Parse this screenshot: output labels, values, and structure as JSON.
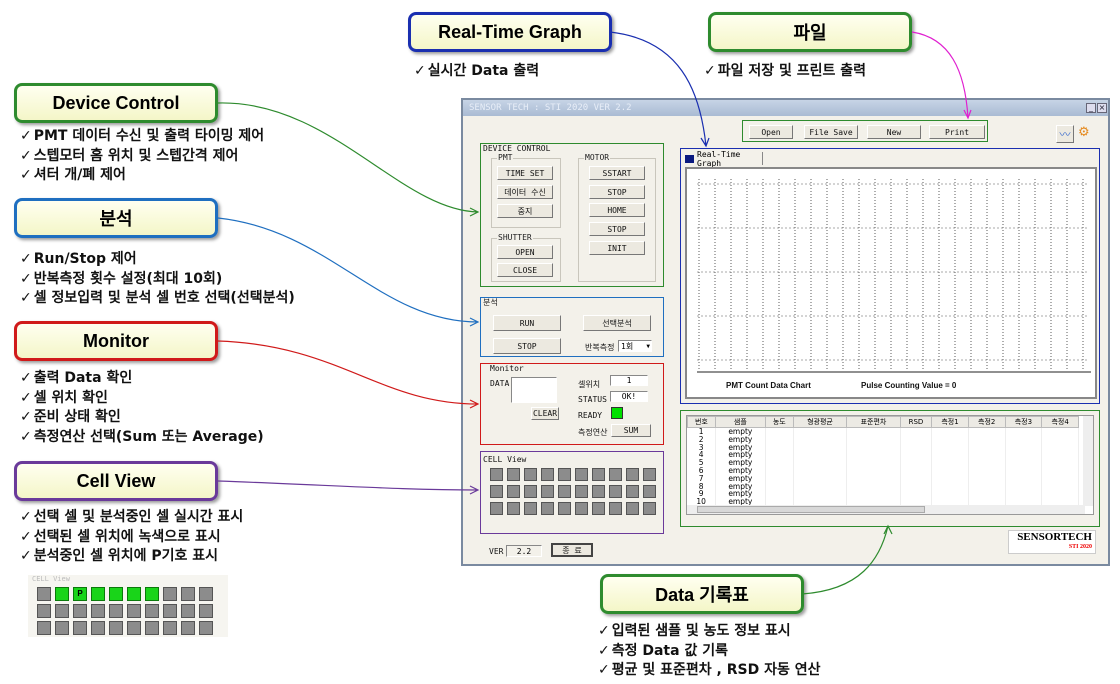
{
  "callouts": {
    "device_control": {
      "title": "Device Control",
      "color": "#2e8b2e",
      "notes": [
        "PMT 데이터 수신 및 출력 타이밍 제어",
        "스텝모터 홈 위치 및 스텝간격 제어",
        "셔터 개/폐 제어"
      ]
    },
    "analysis": {
      "title": "분석",
      "color": "#1f6fc0",
      "notes": [
        "Run/Stop 제어",
        "반복측정 횟수 설정(최대 10회)",
        "셀 정보입력 및 분석 셀 번호 선택(선택분석)"
      ]
    },
    "monitor": {
      "title": "Monitor",
      "color": "#d01a1a",
      "notes": [
        "출력 Data 확인",
        "셀 위치 확인",
        "준비 상태 확인",
        "측정연산 선택(Sum 또는 Average)"
      ]
    },
    "cell_view": {
      "title": "Cell View",
      "color": "#6a3a9a",
      "notes": [
        "선택 셀 및 분석중인 셀 실시간 표시",
        "선택된 셀 위치에 녹색으로 표시",
        "분석중인 셀 위치에 P기호 표시"
      ]
    },
    "realtime": {
      "title": "Real-Time Graph",
      "color": "#1a2fb0",
      "notes": [
        "실시간 Data 출력"
      ]
    },
    "file": {
      "title": "파일",
      "color": "#2e8b2e",
      "notes": [
        "파일 저장 및 프린트 출력"
      ]
    },
    "data_table": {
      "title": "Data 기록표",
      "color": "#2e8b2e",
      "notes": [
        "입력된 샘플 및 농도 정보 표시",
        "측정 Data 값 기록",
        "평균 및 표준편차 , RSD 자동 연산"
      ]
    }
  },
  "example_cell_view": {
    "label": "CELL View",
    "green_cells": [
      2,
      3,
      4,
      5,
      6,
      7
    ],
    "p_cell": 3,
    "p_label": "P"
  },
  "app": {
    "title": "SENSOR TECH : STI 2020  VER 2.2",
    "device_control": {
      "label": "DEVICE CONTROL",
      "pmt": {
        "label": "PMT",
        "buttons": [
          "TIME SET",
          "데이터 수신",
          "중지"
        ]
      },
      "motor": {
        "label": "MOTOR",
        "buttons": [
          "SSTART",
          "STOP",
          "HOME",
          "STOP",
          "INIT"
        ]
      },
      "shutter": {
        "label": "SHUTTER",
        "buttons": [
          "OPEN",
          "CLOSE"
        ]
      }
    },
    "analysis": {
      "label": "분석",
      "run": "RUN",
      "stop": "STOP",
      "select": "선택분석",
      "repeat_label": "반복측정",
      "repeat_value": "1회"
    },
    "monitor": {
      "label": "Monitor",
      "data_label": "DATA",
      "clear": "CLEAR",
      "cell_pos_label": "셀위치",
      "cell_pos": "1",
      "status_label": "STATUS",
      "status": "OK!",
      "ready_label": "READY",
      "ready_color": "#00e000",
      "calc_label": "측정연산",
      "calc_value": "SUM"
    },
    "cell_view": {
      "label": "CELL View"
    },
    "version": {
      "label": "VER",
      "value": "2.2",
      "exit": "종 료"
    },
    "file": {
      "open": "Open",
      "save": "File Save",
      "new": "New",
      "print": "Print"
    },
    "graph": {
      "tab": "Real-Time Graph",
      "chart_title": "PMT Count Data Chart",
      "pulse_label": "Pulse Counting Value = 0"
    },
    "table": {
      "headers": [
        "번호",
        "샘플",
        "농도",
        "형광평균",
        "표준편차",
        "RSD",
        "측정1",
        "측정2",
        "측정3",
        "측정4"
      ],
      "rows": [
        [
          "1",
          "empty"
        ],
        [
          "2",
          "empty"
        ],
        [
          "3",
          "empty"
        ],
        [
          "4",
          "empty"
        ],
        [
          "5",
          "empty"
        ],
        [
          "6",
          "empty"
        ],
        [
          "7",
          "empty"
        ],
        [
          "8",
          "empty"
        ],
        [
          "9",
          "empty"
        ],
        [
          "10",
          "empty"
        ]
      ]
    },
    "logo": {
      "name": "SENSORTECH",
      "sub": "STI 2020"
    }
  }
}
